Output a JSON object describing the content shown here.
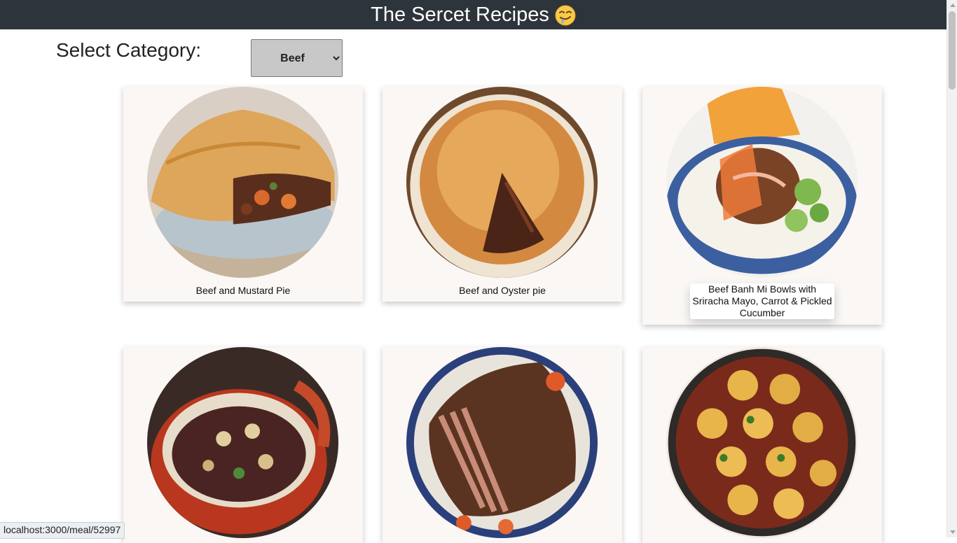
{
  "header": {
    "title": "The Sercet Recipes",
    "emoji_icon": "drooling-face-icon"
  },
  "category": {
    "label": "Select Category:",
    "selected": "Beef"
  },
  "meals": [
    {
      "name": "Beef and Mustard Pie",
      "image_icon": "beef-mustard-pie-photo"
    },
    {
      "name": "Beef and Oyster pie",
      "image_icon": "beef-oyster-pie-photo"
    },
    {
      "name": "Beef Banh Mi Bowls with Sriracha Mayo, Carrot & Pickled Cucumber",
      "image_icon": "banh-mi-bowl-photo"
    },
    {
      "name": "",
      "image_icon": "beef-bourguignon-photo"
    },
    {
      "name": "",
      "image_icon": "beef-brisket-photo"
    },
    {
      "name": "",
      "image_icon": "beef-dumpling-stew-photo"
    }
  ],
  "status_bar": {
    "url": "localhost:3000/meal/52997"
  },
  "colors": {
    "header_bg": "#2d343b",
    "card_bg": "#faf7f5",
    "select_bg": "#c8c8c8"
  }
}
